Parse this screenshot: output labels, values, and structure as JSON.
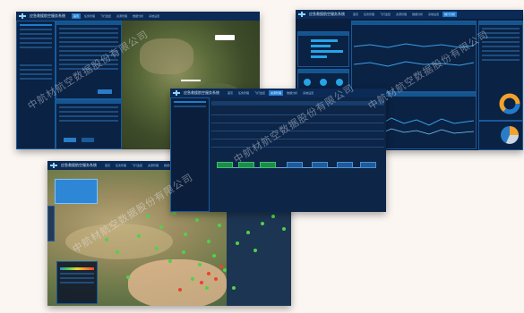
{
  "watermark": "中航材航空数据股份有限公司",
  "screens": {
    "top_left": {
      "title": "应急救援航空服务系统",
      "tabs": [
        "首页",
        "任务管理",
        "飞行监控",
        "资源管理",
        "数据分析",
        "系统设置"
      ]
    },
    "top_right": {
      "title": "应急救援航空服务系统",
      "tabs": [
        "首页",
        "任务管理",
        "飞行监控",
        "资源管理",
        "数据分析",
        "系统设置",
        "统计分析"
      ]
    },
    "middle": {
      "title": "应急救援航空服务系统",
      "tabs": [
        "首页",
        "任务管理",
        "飞行监控",
        "资源管理",
        "数据分析",
        "系统设置"
      ]
    },
    "bottom_left": {
      "title": "应急救援航空服务系统",
      "tabs": [
        "首页",
        "任务管理",
        "飞行监控",
        "资源管理",
        "数据分析",
        "系统设置"
      ]
    }
  },
  "colors": {
    "background": "#fbf6f2",
    "header": "#0b2a55",
    "panel": "#0a2244",
    "accent": "#1e7bd0",
    "status_green": "#52d04a",
    "status_red": "#e8442f",
    "donut_orange": "#f2a22c"
  }
}
